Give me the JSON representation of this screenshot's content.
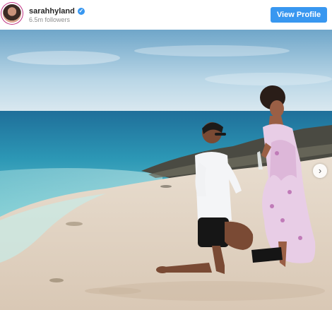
{
  "post": {
    "username": "sarahhyland",
    "followers": "6.5m followers",
    "view_profile_label": "View Profile",
    "verified_icon": "verified-badge-icon",
    "next_icon": "chevron-right-icon"
  },
  "colors": {
    "button": "#3897f0",
    "username": "#262626",
    "followers": "#8e8e8e"
  }
}
